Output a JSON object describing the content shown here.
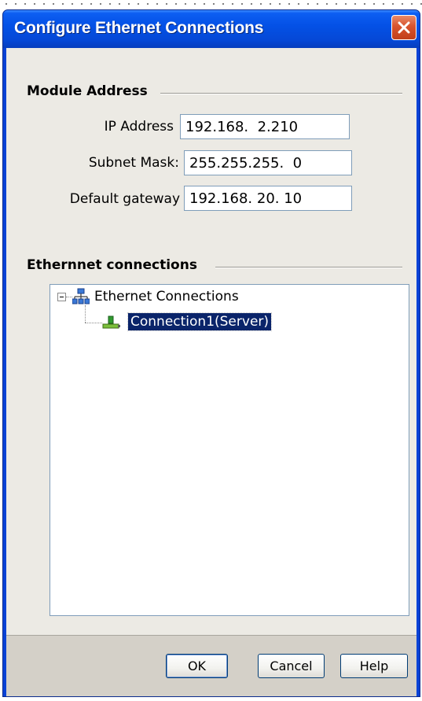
{
  "window": {
    "title": "Configure Ethernet Connections"
  },
  "module_address": {
    "heading": "Module Address",
    "ip_label": "IP Address",
    "ip_value": "192.168.  2.210",
    "subnet_label": "Subnet Mask:",
    "subnet_value": "255.255.255.  0",
    "gateway_label": "Default gateway",
    "gateway_value": "192.168. 20. 10"
  },
  "connections": {
    "heading": "Ethernnet connections",
    "tree": {
      "root_label": "Ethernet Connections",
      "root_icon": "network-icon",
      "child_label": "Connection1(Server)",
      "child_icon": "connection-icon"
    }
  },
  "buttons": {
    "ok": "OK",
    "cancel": "Cancel",
    "help": "Help"
  },
  "colors": {
    "titlebar": "#0451e6",
    "selection": "#0a246a",
    "close": "#d8532d"
  }
}
